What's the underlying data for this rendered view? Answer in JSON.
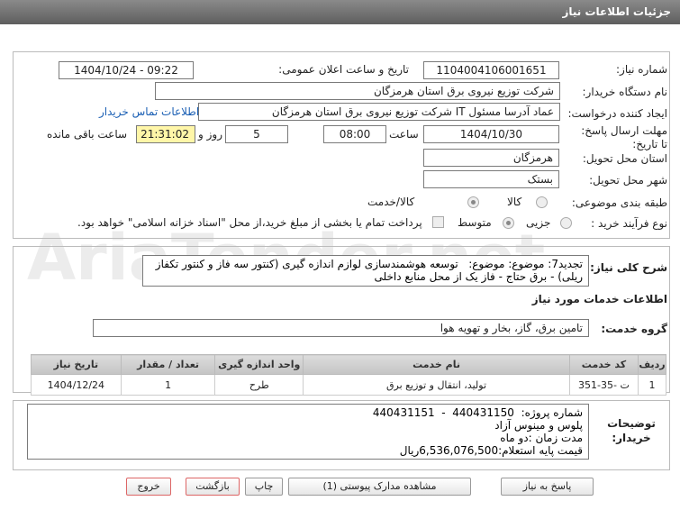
{
  "header": {
    "title": "جزئیات اطلاعات نیاز"
  },
  "form": {
    "need_number_label": "شماره نیاز:",
    "need_number": "1104004106001651",
    "announce_label": "تاریخ و ساعت اعلان عمومی:",
    "announce_value": "1404/10/24 - 09:22",
    "buyer_label": "نام دستگاه خریدار:",
    "buyer_value": "شرکت توزیع نیروی برق استان هرمزگان",
    "creator_label": "ایجاد کننده درخواست:",
    "creator_value": "عماد آدرسا مسئول IT شرکت توزیع نیروی برق استان هرمزگان",
    "contact_link": "اطلاعات تماس خریدار",
    "deadline_label": "مهلت ارسال پاسخ: تا تاریخ:",
    "deadline_date": "1404/10/30",
    "time_label": "ساعت",
    "deadline_time": "08:00",
    "days_value": "5",
    "days_label": "روز و",
    "remaining_time": "21:31:02",
    "remaining_label": "ساعت باقی مانده",
    "province_label": "استان محل تحویل:",
    "province_value": "هرمزگان",
    "city_label": "شهر محل تحویل:",
    "city_value": "بستک",
    "category_label": "طبقه بندی موضوعی:",
    "category_options": [
      "کالا",
      "کالا/خدمت"
    ],
    "process_label": "نوع فرآیند خرید :",
    "process_options": [
      "جزیی",
      "متوسط"
    ],
    "payment_note": "پرداخت تمام یا بخشی از مبلغ خرید،از محل \"اسناد خزانه اسلامی\" خواهد بود."
  },
  "summary": {
    "label": "شرح کلی نیاز:",
    "text": "تجدید7: موضوع: موضوع:   توسعه هوشمندسازی لوازم اندازه گیری (کنتور سه فاز و کنتور تکفاز ریلی) - برق حتاج - فاز یک از محل منابع داخلی"
  },
  "services": {
    "section_title": "اطلاعات خدمات مورد نیاز",
    "group_label": "گروه خدمت:",
    "group_value": "تامین برق، گاز، بخار و تهویه هوا",
    "columns": [
      "ردیف",
      "کد خدمت",
      "نام خدمت",
      "واحد اندازه گیری",
      "تعداد / مقدار",
      "تاریخ نیاز"
    ],
    "rows": [
      [
        "1",
        "ت -35-351",
        "تولید، انتقال و توزیع برق",
        "طرح",
        "1",
        "1404/12/24"
      ]
    ]
  },
  "buyer_notes": {
    "label": "توضیحات خریدار:",
    "text": "شماره پروژه:  440431150  -  440431151\nپلوس و مینوس آزاد\nمدت زمان :دو ماه\nقیمت پایه استعلام:6,536,076,500ریال"
  },
  "buttons": {
    "reply": "پاسخ به نیاز",
    "docs": "مشاهده مدارک پیوستی (1)",
    "print": "چاپ",
    "back": "بازگشت",
    "exit": "خروج"
  },
  "watermark": "AriaTender.net"
}
